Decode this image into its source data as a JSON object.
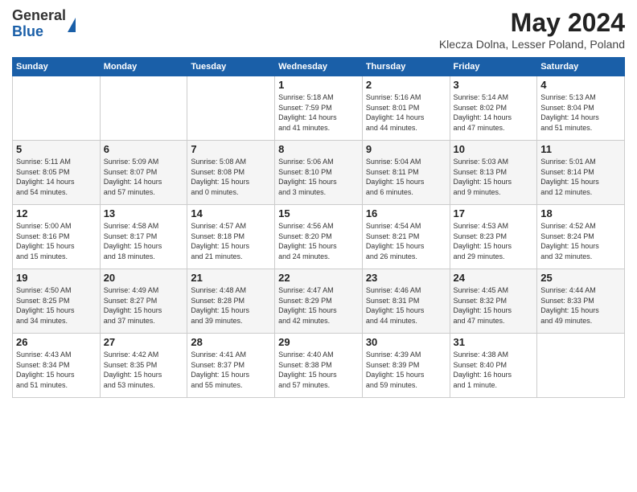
{
  "header": {
    "logo_general": "General",
    "logo_blue": "Blue",
    "title": "May 2024",
    "location": "Klecza Dolna, Lesser Poland, Poland"
  },
  "days_of_week": [
    "Sunday",
    "Monday",
    "Tuesday",
    "Wednesday",
    "Thursday",
    "Friday",
    "Saturday"
  ],
  "weeks": [
    [
      {
        "day": "",
        "info": ""
      },
      {
        "day": "",
        "info": ""
      },
      {
        "day": "",
        "info": ""
      },
      {
        "day": "1",
        "info": "Sunrise: 5:18 AM\nSunset: 7:59 PM\nDaylight: 14 hours\nand 41 minutes."
      },
      {
        "day": "2",
        "info": "Sunrise: 5:16 AM\nSunset: 8:01 PM\nDaylight: 14 hours\nand 44 minutes."
      },
      {
        "day": "3",
        "info": "Sunrise: 5:14 AM\nSunset: 8:02 PM\nDaylight: 14 hours\nand 47 minutes."
      },
      {
        "day": "4",
        "info": "Sunrise: 5:13 AM\nSunset: 8:04 PM\nDaylight: 14 hours\nand 51 minutes."
      }
    ],
    [
      {
        "day": "5",
        "info": "Sunrise: 5:11 AM\nSunset: 8:05 PM\nDaylight: 14 hours\nand 54 minutes."
      },
      {
        "day": "6",
        "info": "Sunrise: 5:09 AM\nSunset: 8:07 PM\nDaylight: 14 hours\nand 57 minutes."
      },
      {
        "day": "7",
        "info": "Sunrise: 5:08 AM\nSunset: 8:08 PM\nDaylight: 15 hours\nand 0 minutes."
      },
      {
        "day": "8",
        "info": "Sunrise: 5:06 AM\nSunset: 8:10 PM\nDaylight: 15 hours\nand 3 minutes."
      },
      {
        "day": "9",
        "info": "Sunrise: 5:04 AM\nSunset: 8:11 PM\nDaylight: 15 hours\nand 6 minutes."
      },
      {
        "day": "10",
        "info": "Sunrise: 5:03 AM\nSunset: 8:13 PM\nDaylight: 15 hours\nand 9 minutes."
      },
      {
        "day": "11",
        "info": "Sunrise: 5:01 AM\nSunset: 8:14 PM\nDaylight: 15 hours\nand 12 minutes."
      }
    ],
    [
      {
        "day": "12",
        "info": "Sunrise: 5:00 AM\nSunset: 8:16 PM\nDaylight: 15 hours\nand 15 minutes."
      },
      {
        "day": "13",
        "info": "Sunrise: 4:58 AM\nSunset: 8:17 PM\nDaylight: 15 hours\nand 18 minutes."
      },
      {
        "day": "14",
        "info": "Sunrise: 4:57 AM\nSunset: 8:18 PM\nDaylight: 15 hours\nand 21 minutes."
      },
      {
        "day": "15",
        "info": "Sunrise: 4:56 AM\nSunset: 8:20 PM\nDaylight: 15 hours\nand 24 minutes."
      },
      {
        "day": "16",
        "info": "Sunrise: 4:54 AM\nSunset: 8:21 PM\nDaylight: 15 hours\nand 26 minutes."
      },
      {
        "day": "17",
        "info": "Sunrise: 4:53 AM\nSunset: 8:23 PM\nDaylight: 15 hours\nand 29 minutes."
      },
      {
        "day": "18",
        "info": "Sunrise: 4:52 AM\nSunset: 8:24 PM\nDaylight: 15 hours\nand 32 minutes."
      }
    ],
    [
      {
        "day": "19",
        "info": "Sunrise: 4:50 AM\nSunset: 8:25 PM\nDaylight: 15 hours\nand 34 minutes."
      },
      {
        "day": "20",
        "info": "Sunrise: 4:49 AM\nSunset: 8:27 PM\nDaylight: 15 hours\nand 37 minutes."
      },
      {
        "day": "21",
        "info": "Sunrise: 4:48 AM\nSunset: 8:28 PM\nDaylight: 15 hours\nand 39 minutes."
      },
      {
        "day": "22",
        "info": "Sunrise: 4:47 AM\nSunset: 8:29 PM\nDaylight: 15 hours\nand 42 minutes."
      },
      {
        "day": "23",
        "info": "Sunrise: 4:46 AM\nSunset: 8:31 PM\nDaylight: 15 hours\nand 44 minutes."
      },
      {
        "day": "24",
        "info": "Sunrise: 4:45 AM\nSunset: 8:32 PM\nDaylight: 15 hours\nand 47 minutes."
      },
      {
        "day": "25",
        "info": "Sunrise: 4:44 AM\nSunset: 8:33 PM\nDaylight: 15 hours\nand 49 minutes."
      }
    ],
    [
      {
        "day": "26",
        "info": "Sunrise: 4:43 AM\nSunset: 8:34 PM\nDaylight: 15 hours\nand 51 minutes."
      },
      {
        "day": "27",
        "info": "Sunrise: 4:42 AM\nSunset: 8:35 PM\nDaylight: 15 hours\nand 53 minutes."
      },
      {
        "day": "28",
        "info": "Sunrise: 4:41 AM\nSunset: 8:37 PM\nDaylight: 15 hours\nand 55 minutes."
      },
      {
        "day": "29",
        "info": "Sunrise: 4:40 AM\nSunset: 8:38 PM\nDaylight: 15 hours\nand 57 minutes."
      },
      {
        "day": "30",
        "info": "Sunrise: 4:39 AM\nSunset: 8:39 PM\nDaylight: 15 hours\nand 59 minutes."
      },
      {
        "day": "31",
        "info": "Sunrise: 4:38 AM\nSunset: 8:40 PM\nDaylight: 16 hours\nand 1 minute."
      },
      {
        "day": "",
        "info": ""
      }
    ]
  ]
}
